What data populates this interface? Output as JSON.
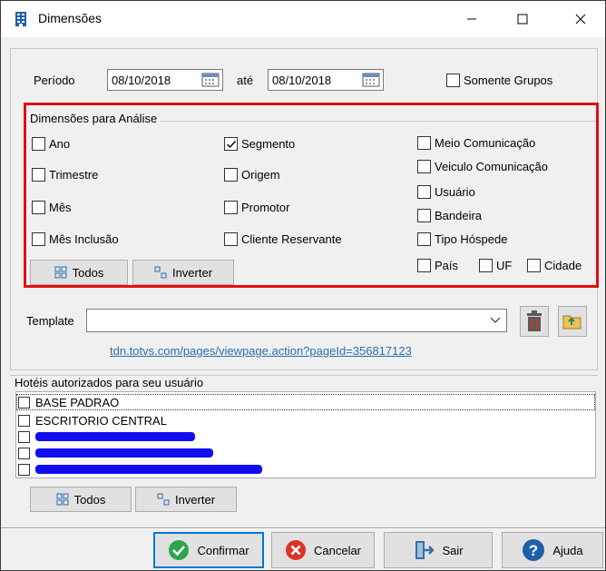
{
  "window": {
    "title": "Dimensões"
  },
  "period": {
    "label": "Período",
    "start": "08/10/2018",
    "until_label": "até",
    "end": "08/10/2018",
    "only_groups_label": "Somente Grupos",
    "only_groups_checked": false
  },
  "dimensions": {
    "title": "Dimensões para Análise",
    "col1": [
      {
        "label": "Ano",
        "checked": false
      },
      {
        "label": "Trimestre",
        "checked": false
      },
      {
        "label": "Mês",
        "checked": false
      },
      {
        "label": "Mês Inclusão",
        "checked": false
      }
    ],
    "col2": [
      {
        "label": "Segmento",
        "checked": true
      },
      {
        "label": "Origem",
        "checked": false
      },
      {
        "label": "Promotor",
        "checked": false
      },
      {
        "label": "Cliente Reservante",
        "checked": false
      }
    ],
    "col3": [
      {
        "label": "Meio Comunicação",
        "checked": false
      },
      {
        "label": "Veiculo Comunicação",
        "checked": false
      },
      {
        "label": "Usuário",
        "checked": false
      },
      {
        "label": "Bandeira",
        "checked": false
      },
      {
        "label": "Tipo Hóspede",
        "checked": false
      }
    ],
    "row_last": [
      {
        "label": "País",
        "checked": false
      },
      {
        "label": "UF",
        "checked": false
      },
      {
        "label": "Cidade",
        "checked": false
      }
    ],
    "all_label": "Todos",
    "invert_label": "Inverter"
  },
  "template": {
    "label": "Template",
    "value": ""
  },
  "link": "tdn.totvs.com/pages/viewpage.action?pageId=356817123",
  "hotels": {
    "title": "Hotéis autorizados para seu usuário",
    "items": [
      "BASE PADRAO",
      "ESCRITORIO CENTRAL",
      "",
      "",
      ""
    ],
    "all_label": "Todos",
    "invert_label": "Inverter"
  },
  "footer": {
    "confirm_label": "Confirmar",
    "cancel_label": "Cancelar",
    "exit_label": "Sair",
    "help_label": "Ajuda"
  },
  "colors": {
    "accent": "#0078d7",
    "highlight_frame": "#e01010",
    "link": "#2a6fb4"
  }
}
